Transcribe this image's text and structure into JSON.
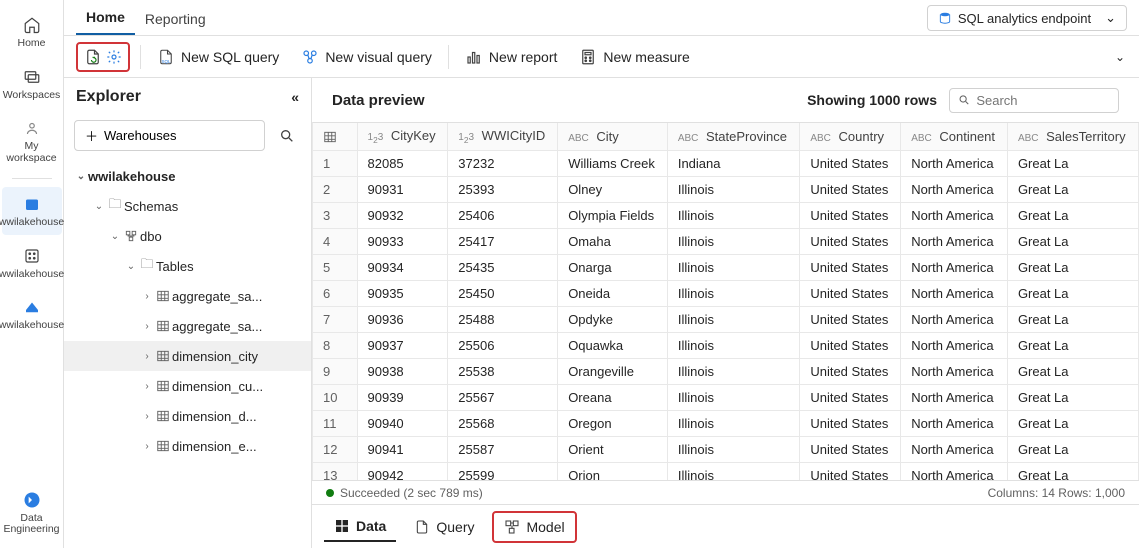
{
  "rail": {
    "items": [
      {
        "label": "Home"
      },
      {
        "label": "Workspaces"
      },
      {
        "label": "My workspace"
      },
      {
        "label": "wwilakehouse"
      },
      {
        "label": "wwilakehouse"
      },
      {
        "label": "wwilakehouse"
      },
      {
        "label": "Data Engineering"
      }
    ]
  },
  "topTabs": {
    "home": "Home",
    "reporting": "Reporting"
  },
  "endpoint": {
    "label": "SQL analytics endpoint"
  },
  "toolbar": {
    "newSql": "New SQL query",
    "newVisual": "New visual query",
    "newReport": "New report",
    "newMeasure": "New measure"
  },
  "explorer": {
    "title": "Explorer",
    "warehouses": "Warehouses",
    "tree": {
      "db": "wwilakehouse",
      "schemas": "Schemas",
      "dbo": "dbo",
      "tables": "Tables",
      "items": [
        "aggregate_sa...",
        "aggregate_sa...",
        "dimension_city",
        "dimension_cu...",
        "dimension_d...",
        "dimension_e..."
      ]
    }
  },
  "preview": {
    "title": "Data preview",
    "showing": "Showing 1000 rows",
    "searchPlaceholder": "Search",
    "columns": [
      {
        "type": "num",
        "label": "CityKey"
      },
      {
        "type": "num",
        "label": "WWICityID"
      },
      {
        "type": "abc",
        "label": "City"
      },
      {
        "type": "abc",
        "label": "StateProvince"
      },
      {
        "type": "abc",
        "label": "Country"
      },
      {
        "type": "abc",
        "label": "Continent"
      },
      {
        "type": "abc",
        "label": "SalesTerritory"
      }
    ],
    "rows": [
      [
        "82085",
        "37232",
        "Williams Creek",
        "Indiana",
        "United States",
        "North America",
        "Great La"
      ],
      [
        "90931",
        "25393",
        "Olney",
        "Illinois",
        "United States",
        "North America",
        "Great La"
      ],
      [
        "90932",
        "25406",
        "Olympia Fields",
        "Illinois",
        "United States",
        "North America",
        "Great La"
      ],
      [
        "90933",
        "25417",
        "Omaha",
        "Illinois",
        "United States",
        "North America",
        "Great La"
      ],
      [
        "90934",
        "25435",
        "Onarga",
        "Illinois",
        "United States",
        "North America",
        "Great La"
      ],
      [
        "90935",
        "25450",
        "Oneida",
        "Illinois",
        "United States",
        "North America",
        "Great La"
      ],
      [
        "90936",
        "25488",
        "Opdyke",
        "Illinois",
        "United States",
        "North America",
        "Great La"
      ],
      [
        "90937",
        "25506",
        "Oquawka",
        "Illinois",
        "United States",
        "North America",
        "Great La"
      ],
      [
        "90938",
        "25538",
        "Orangeville",
        "Illinois",
        "United States",
        "North America",
        "Great La"
      ],
      [
        "90939",
        "25567",
        "Oreana",
        "Illinois",
        "United States",
        "North America",
        "Great La"
      ],
      [
        "90940",
        "25568",
        "Oregon",
        "Illinois",
        "United States",
        "North America",
        "Great La"
      ],
      [
        "90941",
        "25587",
        "Orient",
        "Illinois",
        "United States",
        "North America",
        "Great La"
      ],
      [
        "90942",
        "25599",
        "Orion",
        "Illinois",
        "United States",
        "North America",
        "Great La"
      ]
    ],
    "status": "Succeeded (2 sec 789 ms)",
    "footer": "Columns: 14  Rows: 1,000"
  },
  "bottomTabs": {
    "data": "Data",
    "query": "Query",
    "model": "Model"
  }
}
